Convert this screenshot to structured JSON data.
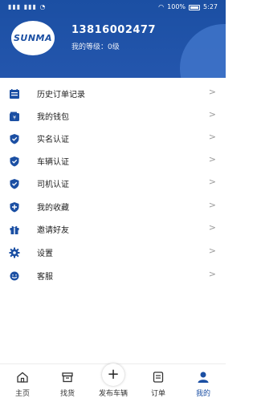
{
  "status_bar": {
    "time": "5:27",
    "battery": "100%"
  },
  "profile": {
    "logo_text": "SUNMA",
    "phone": "13816002477",
    "level": "我的等级：0级"
  },
  "menu": [
    {
      "label": "历史订单记录",
      "icon": "order-history-icon"
    },
    {
      "label": "我的钱包",
      "icon": "wallet-icon"
    },
    {
      "label": "实名认证",
      "icon": "shield-check-icon"
    },
    {
      "label": "车辆认证",
      "icon": "shield-check-icon"
    },
    {
      "label": "司机认证",
      "icon": "shield-check-icon"
    },
    {
      "label": "我的收藏",
      "icon": "favorite-shield-icon"
    },
    {
      "label": "邀请好友",
      "icon": "gift-icon"
    },
    {
      "label": "设置",
      "icon": "gear-icon"
    },
    {
      "label": "客服",
      "icon": "customer-service-icon"
    }
  ],
  "chevron": ">",
  "tabs": [
    {
      "label": "主页",
      "icon": "home-icon"
    },
    {
      "label": "找货",
      "icon": "box-icon"
    },
    {
      "label": "发布车辆",
      "icon": "plus-icon"
    },
    {
      "label": "订单",
      "icon": "order-list-icon"
    },
    {
      "label": "我的",
      "icon": "user-icon",
      "active": true
    }
  ],
  "colors": {
    "brand": "#1b4fa3",
    "text": "#222222",
    "muted": "#9a9a9a"
  }
}
